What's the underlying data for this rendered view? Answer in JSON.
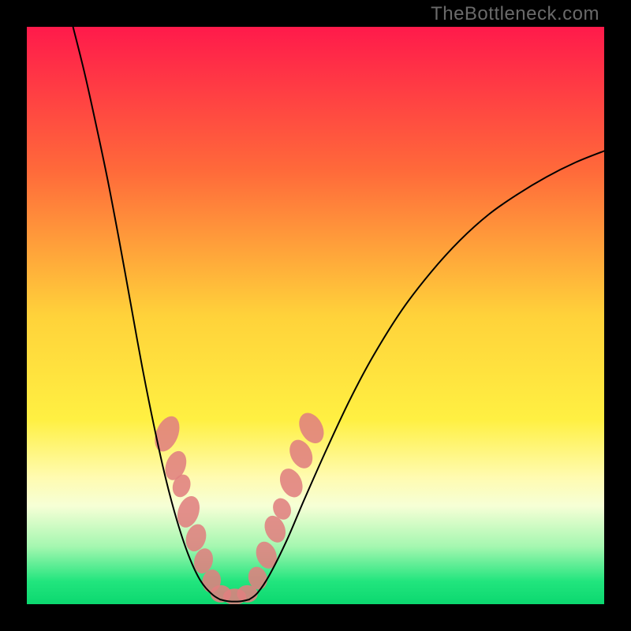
{
  "watermark": "TheBottleneck.com",
  "chart_data": {
    "type": "line",
    "title": "",
    "xlabel": "",
    "ylabel": "",
    "xlim": [
      0,
      100
    ],
    "ylim": [
      0,
      100
    ],
    "background_gradient": {
      "stops": [
        {
          "offset": 0.0,
          "color": "#ff1a4b"
        },
        {
          "offset": 0.25,
          "color": "#ff6a3a"
        },
        {
          "offset": 0.5,
          "color": "#ffd23a"
        },
        {
          "offset": 0.68,
          "color": "#fff042"
        },
        {
          "offset": 0.78,
          "color": "#fffbb0"
        },
        {
          "offset": 0.83,
          "color": "#f6ffd6"
        },
        {
          "offset": 0.9,
          "color": "#a5f7b0"
        },
        {
          "offset": 0.96,
          "color": "#22e57e"
        },
        {
          "offset": 1.0,
          "color": "#0bd86f"
        }
      ]
    },
    "series": [
      {
        "name": "left-curve",
        "color": "#000000",
        "width": 2,
        "points": [
          {
            "x": 8.0,
            "y": 100.0
          },
          {
            "x": 10.0,
            "y": 92.0
          },
          {
            "x": 12.0,
            "y": 83.0
          },
          {
            "x": 14.0,
            "y": 73.5
          },
          {
            "x": 16.0,
            "y": 63.0
          },
          {
            "x": 18.0,
            "y": 52.0
          },
          {
            "x": 20.0,
            "y": 41.0
          },
          {
            "x": 22.0,
            "y": 31.0
          },
          {
            "x": 24.0,
            "y": 22.0
          },
          {
            "x": 26.0,
            "y": 14.5
          },
          {
            "x": 28.0,
            "y": 8.5
          },
          {
            "x": 30.0,
            "y": 4.2
          },
          {
            "x": 32.0,
            "y": 1.8
          },
          {
            "x": 33.5,
            "y": 0.8
          }
        ]
      },
      {
        "name": "valley",
        "color": "#000000",
        "width": 2,
        "points": [
          {
            "x": 33.5,
            "y": 0.8
          },
          {
            "x": 35.0,
            "y": 0.5
          },
          {
            "x": 37.0,
            "y": 0.5
          },
          {
            "x": 38.5,
            "y": 0.8
          }
        ]
      },
      {
        "name": "right-curve",
        "color": "#000000",
        "width": 2,
        "points": [
          {
            "x": 38.5,
            "y": 0.8
          },
          {
            "x": 40.0,
            "y": 2.0
          },
          {
            "x": 42.0,
            "y": 5.0
          },
          {
            "x": 45.0,
            "y": 11.0
          },
          {
            "x": 48.0,
            "y": 18.0
          },
          {
            "x": 52.0,
            "y": 27.0
          },
          {
            "x": 56.0,
            "y": 35.5
          },
          {
            "x": 60.0,
            "y": 43.0
          },
          {
            "x": 65.0,
            "y": 51.0
          },
          {
            "x": 70.0,
            "y": 57.5
          },
          {
            "x": 75.0,
            "y": 63.0
          },
          {
            "x": 80.0,
            "y": 67.5
          },
          {
            "x": 85.0,
            "y": 71.0
          },
          {
            "x": 90.0,
            "y": 74.0
          },
          {
            "x": 95.0,
            "y": 76.5
          },
          {
            "x": 100.0,
            "y": 78.5
          }
        ]
      }
    ],
    "blob_clusters": [
      {
        "name": "left-cluster",
        "color": "#e08080",
        "ellipses": [
          {
            "cx": 24.3,
            "cy": 29.5,
            "rx": 1.9,
            "ry": 3.2,
            "rot": 22
          },
          {
            "cx": 25.8,
            "cy": 24.0,
            "rx": 1.7,
            "ry": 2.6,
            "rot": 20
          },
          {
            "cx": 26.8,
            "cy": 20.5,
            "rx": 1.5,
            "ry": 2.0,
            "rot": 18
          },
          {
            "cx": 28.0,
            "cy": 16.0,
            "rx": 1.8,
            "ry": 2.8,
            "rot": 18
          },
          {
            "cx": 29.3,
            "cy": 11.5,
            "rx": 1.7,
            "ry": 2.4,
            "rot": 16
          },
          {
            "cx": 30.6,
            "cy": 7.5,
            "rx": 1.6,
            "ry": 2.2,
            "rot": 14
          },
          {
            "cx": 32.0,
            "cy": 4.0,
            "rx": 1.6,
            "ry": 2.0,
            "rot": 10
          }
        ]
      },
      {
        "name": "valley-cluster",
        "color": "#e08080",
        "ellipses": [
          {
            "cx": 33.6,
            "cy": 1.8,
            "rx": 1.8,
            "ry": 1.5,
            "rot": 0
          },
          {
            "cx": 36.0,
            "cy": 1.3,
            "rx": 2.0,
            "ry": 1.4,
            "rot": 0
          },
          {
            "cx": 38.2,
            "cy": 1.8,
            "rx": 1.8,
            "ry": 1.5,
            "rot": 0
          }
        ]
      },
      {
        "name": "right-cluster",
        "color": "#e08080",
        "ellipses": [
          {
            "cx": 40.0,
            "cy": 4.5,
            "rx": 1.6,
            "ry": 2.0,
            "rot": -18
          },
          {
            "cx": 41.5,
            "cy": 8.5,
            "rx": 1.7,
            "ry": 2.4,
            "rot": -20
          },
          {
            "cx": 43.0,
            "cy": 13.0,
            "rx": 1.7,
            "ry": 2.4,
            "rot": -22
          },
          {
            "cx": 44.2,
            "cy": 16.5,
            "rx": 1.5,
            "ry": 1.9,
            "rot": -22
          },
          {
            "cx": 45.8,
            "cy": 21.0,
            "rx": 1.8,
            "ry": 2.6,
            "rot": -24
          },
          {
            "cx": 47.5,
            "cy": 26.0,
            "rx": 1.8,
            "ry": 2.6,
            "rot": -26
          },
          {
            "cx": 49.3,
            "cy": 30.5,
            "rx": 1.9,
            "ry": 2.8,
            "rot": -28
          }
        ]
      }
    ]
  }
}
